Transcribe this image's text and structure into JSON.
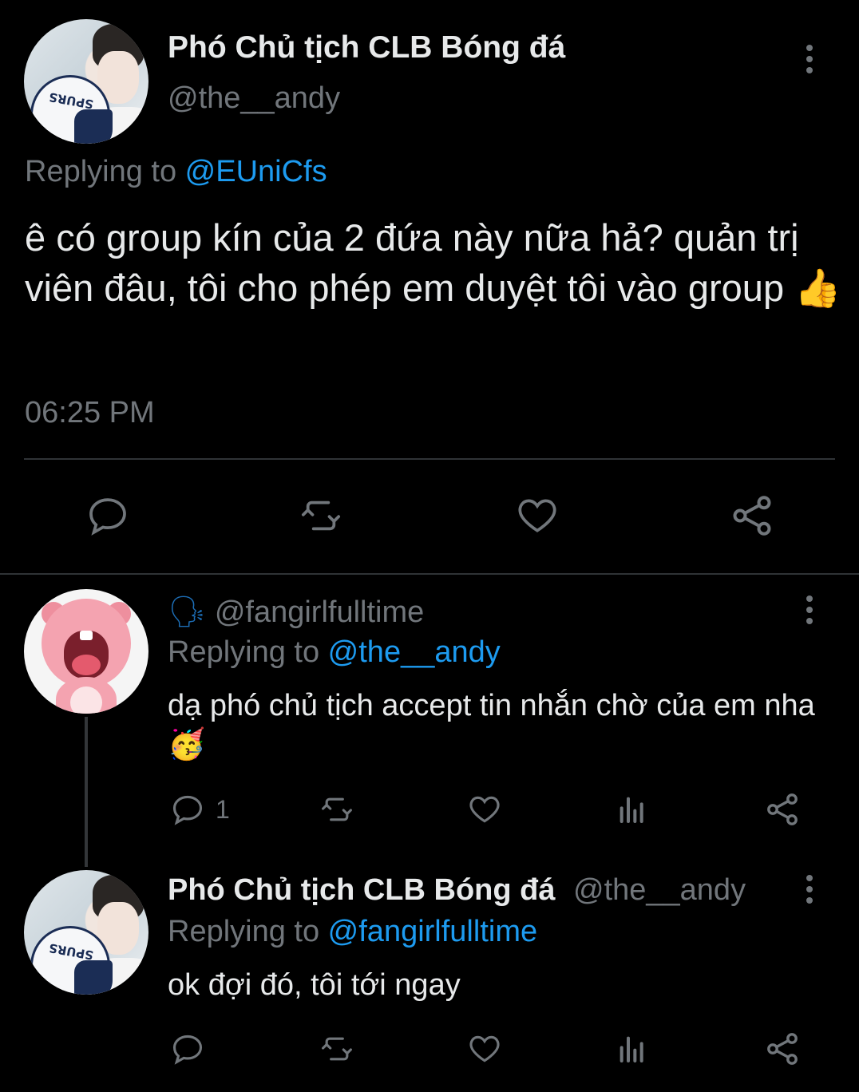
{
  "main_tweet": {
    "display_name": "Phó Chủ tịch CLB Bóng đá",
    "handle": "@the__andy",
    "replying_prefix": "Replying to ",
    "replying_to": "@EUniCfs",
    "text": "ê có group kín của 2 đứa này nữa hả? quản trị viên đâu, tôi cho phép em duyệt tôi vào group",
    "text_emoji": "👍",
    "timestamp": "06:25 PM",
    "actions": [
      "reply-icon",
      "retweet-icon",
      "like-icon",
      "share-icon"
    ]
  },
  "reply_1": {
    "name_emoji": "🗣",
    "handle": "@fangirlfulltime",
    "replying_prefix": "Replying to ",
    "replying_to": "@the__andy",
    "text": "dạ phó chủ tịch accept tin nhắn chờ của em nha",
    "text_emoji": "🥳",
    "reply_count": "1",
    "actions": [
      "reply-icon",
      "retweet-icon",
      "like-icon",
      "analytics-icon",
      "share-icon"
    ]
  },
  "reply_2": {
    "display_name": "Phó Chủ tịch CLB Bóng đá",
    "handle": "@the__andy",
    "replying_prefix": "Replying to ",
    "replying_to": "@fangirlfulltime",
    "text": "ok đợi đó, tôi tới ngay",
    "actions": [
      "reply-icon",
      "retweet-icon",
      "like-icon",
      "analytics-icon",
      "share-icon"
    ]
  },
  "avatar_ball_text": "SPURS",
  "colors": {
    "background": "#000000",
    "text": "#e7e9ea",
    "muted": "#71767b",
    "accent": "#1d9bf0",
    "divider": "#2f3336"
  }
}
